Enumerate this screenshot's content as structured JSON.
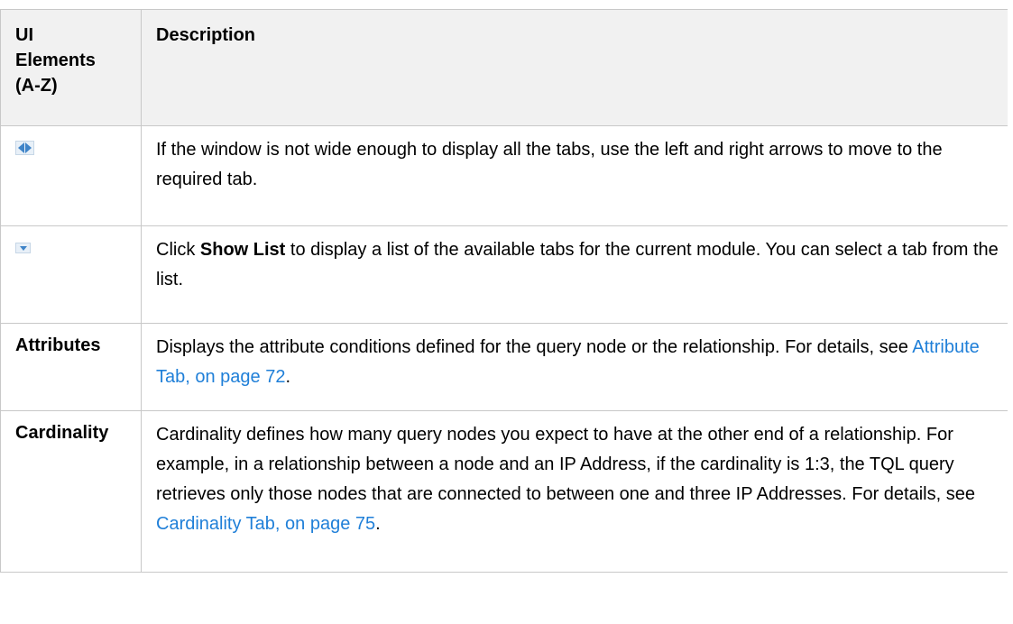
{
  "table": {
    "header": {
      "col1_line1": "UI",
      "col1_line2": "Elements",
      "col1_line3": "(A-Z)",
      "col2": "Description"
    },
    "rows": [
      {
        "element_icon": "left-right-arrows-icon",
        "description": "If the window is not wide enough to display all the tabs, use the left and right arrows to move to the required tab."
      },
      {
        "element_icon": "show-list-dropdown-icon",
        "desc_pre": "Click ",
        "desc_bold": "Show List",
        "desc_post": " to display a list of the available tabs for the current module. You can select a tab from the list."
      },
      {
        "element": "Attributes",
        "desc_pre": "Displays the attribute conditions defined for the query node or the relationship. For details, see ",
        "desc_link": "Attribute Tab, on page 72",
        "desc_post": "."
      },
      {
        "element": "Cardinality",
        "desc_pre": "Cardinality defines how many query nodes you expect to have at the other end of a relationship. For example, in a relationship between a node and an IP Address, if the cardinality is 1:3, the TQL query retrieves only those nodes that are connected to between one and three IP Addresses. For details, see ",
        "desc_link": "Cardinality Tab, on page 75",
        "desc_post": "."
      }
    ]
  },
  "colors": {
    "header_bg": "#f1f1f1",
    "border": "#c8c8c8",
    "link": "#1f7fd8",
    "icon_accent": "#3f84c8"
  }
}
